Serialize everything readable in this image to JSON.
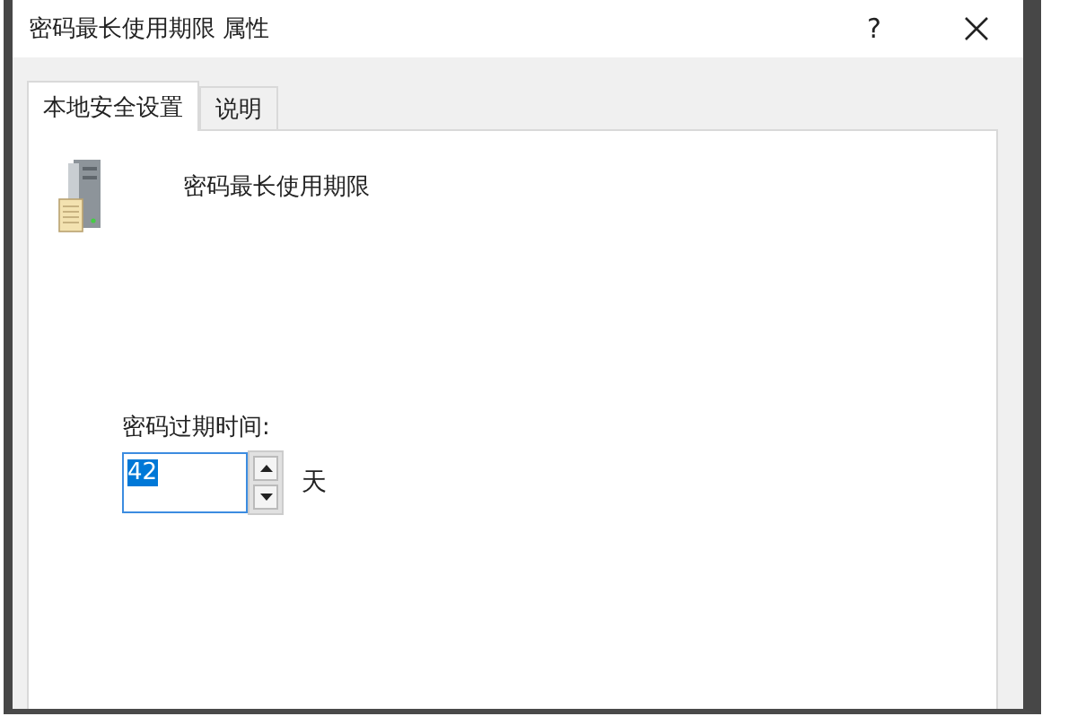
{
  "window": {
    "title": "密码最长使用期限 属性",
    "help_button": "?"
  },
  "tabs": [
    {
      "label": "本地安全设置",
      "selected": true
    },
    {
      "label": "说明",
      "selected": false
    }
  ],
  "policy": {
    "name": "密码最长使用期限"
  },
  "expiry": {
    "label": "密码过期时间:",
    "value": "42",
    "value_selected": true,
    "unit": "天"
  }
}
